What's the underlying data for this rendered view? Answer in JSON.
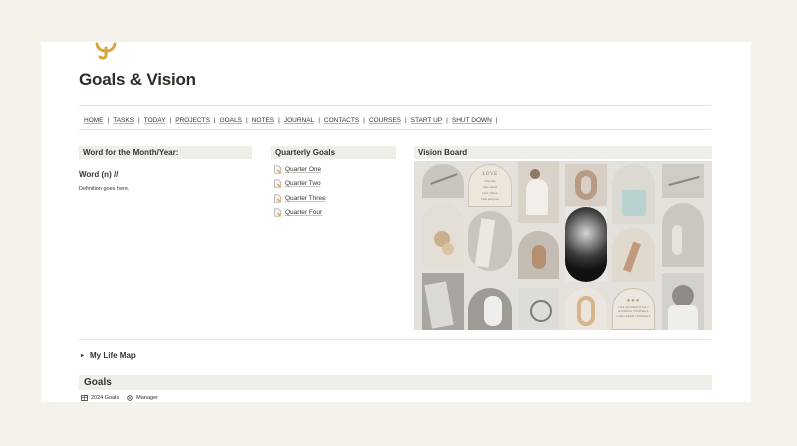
{
  "page": {
    "title": "Goals & Vision"
  },
  "nav": {
    "items": [
      "HOME",
      "TASKS",
      "TODAY",
      "PROJECTS",
      "GOALS",
      "NOTES",
      "JOURNAL",
      "CONTACTS",
      "COURSES",
      "START UP",
      "SHUT DOWN"
    ],
    "separator": "|"
  },
  "word_section": {
    "heading": "Word for the Month/Year:",
    "word": "Word (n) //",
    "definition": "Definition goes here."
  },
  "quarterly": {
    "heading": "Quarterly Goals",
    "items": [
      "Quarter One",
      "Quarter Two",
      "Quarter Three",
      "Quarter Four"
    ],
    "icon": "page-icon"
  },
  "vision": {
    "heading": "Vision Board",
    "love_card": {
      "title": "LOVE",
      "lines": [
        "One life",
        "One heart",
        "One vision",
        "One purpose"
      ]
    },
    "small_card": {
      "lines": [
        "LIVE AUTHENTICALLY",
        "EXPRESS YOURSELF",
        "CHALLENGE YOURSELF"
      ]
    }
  },
  "life_map": {
    "label": "My Life Map",
    "toggle": "▸"
  },
  "goals": {
    "heading": "Goals",
    "views": [
      {
        "icon": "table-icon",
        "label": "2024 Goals"
      },
      {
        "icon": "gear-icon",
        "label": "Manager"
      }
    ]
  },
  "colors": {
    "background": "#f5f2ec",
    "card": "#ffffff",
    "header_bg": "#efeee8",
    "logo": "#d9a43a",
    "text": "#37352f"
  }
}
